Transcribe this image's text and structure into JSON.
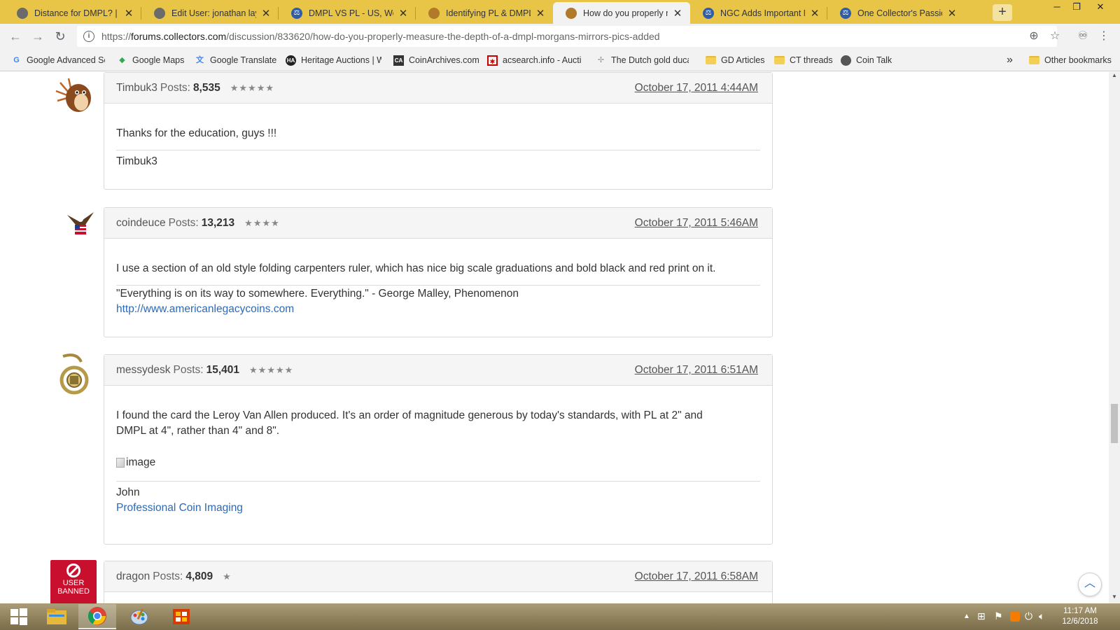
{
  "tabs": [
    {
      "title": "Distance for DMPL? | Coin Talk",
      "favicon": "coin-talk-icon"
    },
    {
      "title": "Edit User: jonathan layne",
      "favicon": "coin-talk-icon"
    },
    {
      "title": "DMPL VS PL - US, World, and Ancient Coins",
      "favicon": "ngc-icon"
    },
    {
      "title": "Identifying PL & DMPL Morgans",
      "favicon": "collectors-icon"
    },
    {
      "title": "How do you properly measure the depth",
      "favicon": "collectors-icon"
    },
    {
      "title": "NGC Adds Important New Designations",
      "favicon": "ngc-icon"
    },
    {
      "title": "One Collector's Passion: The DMPL",
      "favicon": "ngc-icon"
    }
  ],
  "url": {
    "prefix": "https://",
    "domain": "forums.collectors.com",
    "path": "/discussion/833620/how-do-you-properly-measure-the-depth-of-a-dmpl-morgans-mirrors-pics-added"
  },
  "bookmarks": [
    {
      "label": "Google Advanced Search",
      "icon": "google-icon"
    },
    {
      "label": "Google Maps",
      "icon": "maps-icon"
    },
    {
      "label": "Google Translate",
      "icon": "translate-icon"
    },
    {
      "label": "Heritage Auctions | World",
      "icon": "heritage-icon"
    },
    {
      "label": "CoinArchives.com",
      "icon": "coinarchives-icon"
    },
    {
      "label": "acsearch.info - Auction",
      "icon": "acsearch-icon"
    },
    {
      "label": "The Dutch gold ducat",
      "icon": "dutch-ducat-icon"
    },
    {
      "label": "GD Articles",
      "icon": "folder-icon"
    },
    {
      "label": "CT threads",
      "icon": "folder-icon"
    },
    {
      "label": "Coin Talk",
      "icon": "coin-talk-icon"
    }
  ],
  "bookmarks_more": "»",
  "other_bookmarks": "Other bookmarks",
  "posts": [
    {
      "user": "Timbuk3",
      "posts_label": "Posts:",
      "posts_count": "8,535",
      "stars": "★★★★★",
      "date": "October 17, 2011 4:44AM",
      "body": [
        "Thanks for the education, guys !!!"
      ],
      "signature": [
        "Timbuk3"
      ],
      "signature_link": ""
    },
    {
      "user": "coindeuce",
      "posts_label": "Posts:",
      "posts_count": "13,213",
      "stars": "★★★★",
      "date": "October 17, 2011 5:46AM",
      "body": [
        "I use a section of an old style folding carpenters ruler, which has nice big scale graduations and bold black and red print on it."
      ],
      "signature": [
        "\"Everything is on its way to somewhere. Everything.\" - George Malley, Phenomenon"
      ],
      "signature_link": "http://www.americanlegacycoins.com"
    },
    {
      "user": "messydesk",
      "posts_label": "Posts:",
      "posts_count": "15,401",
      "stars": "★★★★★",
      "date": "October 17, 2011 6:51AM",
      "body": [
        "I found the card the Leroy Van Allen produced. It's an order of magnitude generous by today's standards, with PL at 2\" and",
        "DMPL at 4\", rather than 4\" and 8\"."
      ],
      "image_alt": "image",
      "signature": [
        "John"
      ],
      "signature_link": "Professional Coin Imaging"
    },
    {
      "user": "dragon",
      "posts_label": "Posts:",
      "posts_count": "4,809",
      "stars": "★",
      "date": "October 17, 2011 6:58AM"
    }
  ],
  "banned_avatar": {
    "line1": "USER",
    "line2": "BANNED"
  },
  "clock": {
    "time": "11:17 AM",
    "date": "12/6/2018"
  },
  "colors": {
    "chrome_frame": "#e8c547",
    "link": "#2a6ab8",
    "banned_red": "#c8102e"
  }
}
